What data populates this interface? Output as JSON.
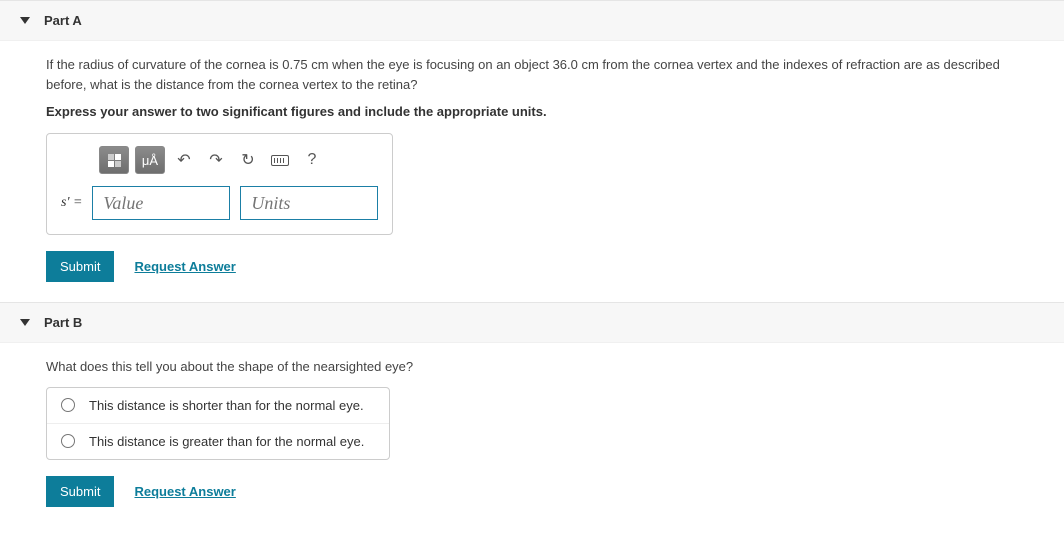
{
  "partA": {
    "title": "Part A",
    "question": "If the radius of curvature of the cornea is 0.75 cm when the eye is focusing on an object 36.0 cm from the cornea vertex and the indexes of refraction are as described before, what is the distance from the cornea vertex to the retina?",
    "instruction": "Express your answer to two significant figures and include the appropriate units.",
    "var_label": "s' =",
    "value_placeholder": "Value",
    "units_placeholder": "Units",
    "toolbar": {
      "units_btn": "μÅ",
      "help_btn": "?"
    },
    "submit_label": "Submit",
    "request_label": "Request Answer"
  },
  "partB": {
    "title": "Part B",
    "question": "What does this tell you about the shape of the nearsighted eye?",
    "options": [
      "This distance is shorter than for the normal eye.",
      "This distance is greater than for the normal eye."
    ],
    "submit_label": "Submit",
    "request_label": "Request Answer"
  }
}
